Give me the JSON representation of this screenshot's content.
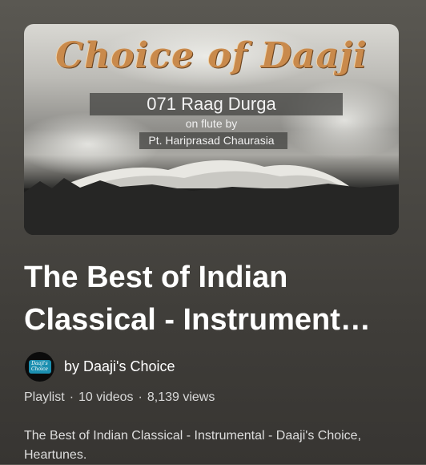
{
  "thumbnail": {
    "title_text": "Choice of Daaji",
    "raag": "071 Raag Durga",
    "instrument": "on flute by",
    "artist": "Pt. Hariprasad Chaurasia"
  },
  "playlist": {
    "title": "The Best of Indian Classical - Instrument…",
    "channel": "by Daaji's Choice",
    "type": "Playlist",
    "video_count": "10 videos",
    "views": "8,139 views",
    "description": "The Best of Indian Classical - Instrumental - Daaji's Choice, Heartunes."
  },
  "avatar": {
    "text": "Daaji's Choice",
    "color": "#1c8fb0"
  }
}
